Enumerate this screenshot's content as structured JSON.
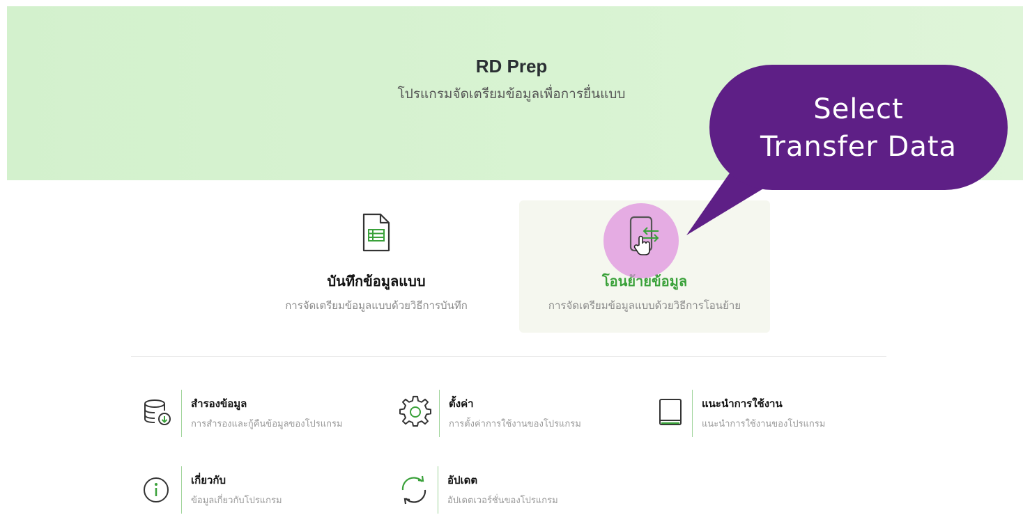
{
  "header": {
    "title": "RD Prep",
    "subtitle": "โปรแกรมจัดเตรียมข้อมูลเพื่อการยื่นแบบ"
  },
  "callout": {
    "line1": "Select",
    "line2": "Transfer Data",
    "color": "#5e1f86"
  },
  "main_options": [
    {
      "title": "บันทึกข้อมูลแบบ",
      "description": "การจัดเตรียมข้อมูลแบบด้วยวิธีการบันทึก",
      "icon": "document-list-icon"
    },
    {
      "title": "โอนย้ายข้อมูล",
      "description": "การจัดเตรียมข้อมูลแบบด้วยวิธีการโอนย้าย",
      "icon": "transfer-icon",
      "highlighted": true
    }
  ],
  "menu": [
    {
      "title": "สำรองข้อมูล",
      "description": "การสำรองและกู้คืนข้อมูลของโปรแกรม",
      "icon": "database-download-icon"
    },
    {
      "title": "ตั้งค่า",
      "description": "การตั้งค่าการใช้งานของโปรแกรม",
      "icon": "gear-icon"
    },
    {
      "title": "แนะนำการใช้งาน",
      "description": "แนะนำการใช้งานของโปรแกรม",
      "icon": "book-icon"
    },
    {
      "title": "เกี่ยวกับ",
      "description": "ข้อมูลเกี่ยวกับโปรแกรม",
      "icon": "info-icon"
    },
    {
      "title": "อัปเดต",
      "description": "อัปเดตเวอร์ชั่นของโปรแกรม",
      "icon": "refresh-icon"
    }
  ],
  "colors": {
    "accent_green": "#3aa13a",
    "hero_bg": "#d6f2d0",
    "highlight": "#de8cde"
  }
}
